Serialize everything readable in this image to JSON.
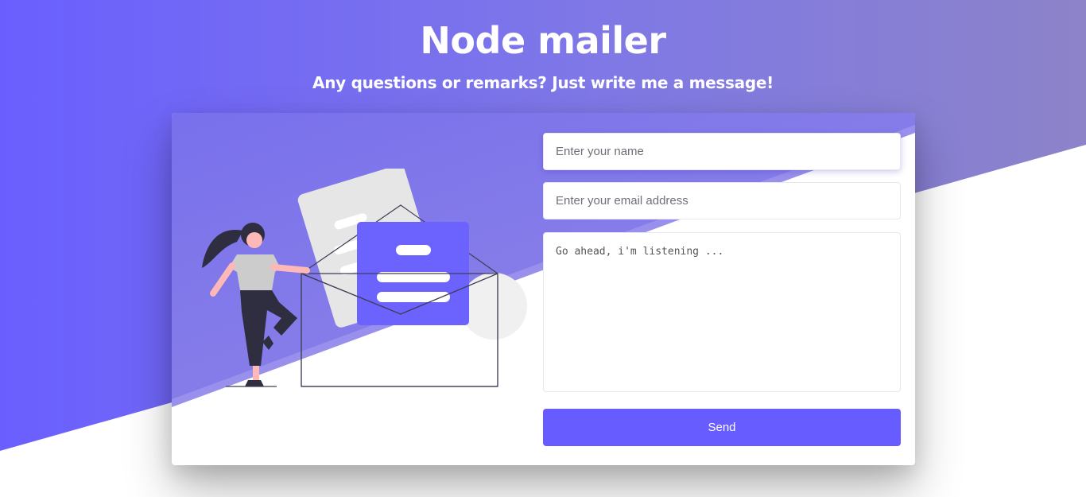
{
  "header": {
    "title": "Node mailer",
    "subtitle": "Any questions or remarks? Just write me a message!"
  },
  "form": {
    "name_placeholder": "Enter your name",
    "email_placeholder": "Enter your email address",
    "message_placeholder": "Go ahead, i'm listening ...",
    "send_label": "Send"
  },
  "colors": {
    "accent": "#675cff",
    "background_gradient_start": "#6a5ffe",
    "background_gradient_end": "#8c83c9"
  },
  "illustration": {
    "icon": "woman-opening-envelope-illustration"
  }
}
